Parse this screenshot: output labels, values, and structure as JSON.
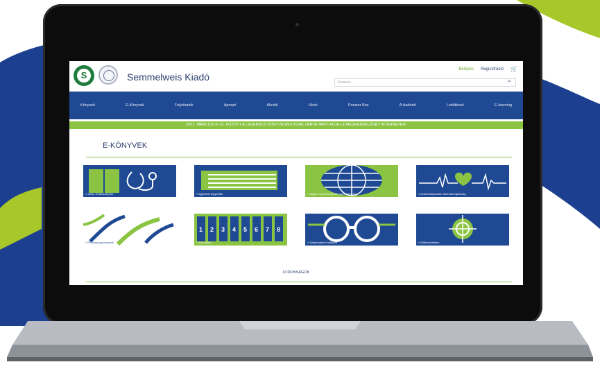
{
  "site": {
    "brand": "Semmelweis Kiadó",
    "top_links": {
      "login": "Belépés",
      "register": "Regisztráció",
      "cart_icon": "cart-icon"
    },
    "search": {
      "placeholder": "Keresés..."
    },
    "nav": [
      "Könyvek",
      "E-Könyvek",
      "Folyóiratok",
      "Apropó",
      "Akciók",
      "Hírek",
      "Poszter Box",
      "A kiadóról",
      "Letöltések",
      "E-learning"
    ],
    "banner": "2021. MÁRCIUS 8–22. KÖZÖTT A LEGENDUS KÖNYVESBOLTUNK ZÁRVA TART! ADJA LE MEGRENDELÉSÉT INTERNETEN!",
    "section_title": "E-KÖNYVEK",
    "categories": [
      "» Szak- és tankönyvek",
      "» Egyetemi jegyzetek",
      "» Idegen nyelvű könyvek, nyelvkönyvek",
      "» Ismeretterjesztés, életmód-egészség",
      "» Próbaanyag könyvek",
      "» Sorozatok",
      "» Szépirodalmi irodalom",
      "» Előkészületben"
    ],
    "news_label": "ÚJDONSÁGOK"
  },
  "colors": {
    "navy": "#1f4a93",
    "green": "#8bc443",
    "dark_green": "#1e7d3c",
    "bg_blue": "#1c3f8f",
    "bg_lime": "#a7c72a"
  }
}
